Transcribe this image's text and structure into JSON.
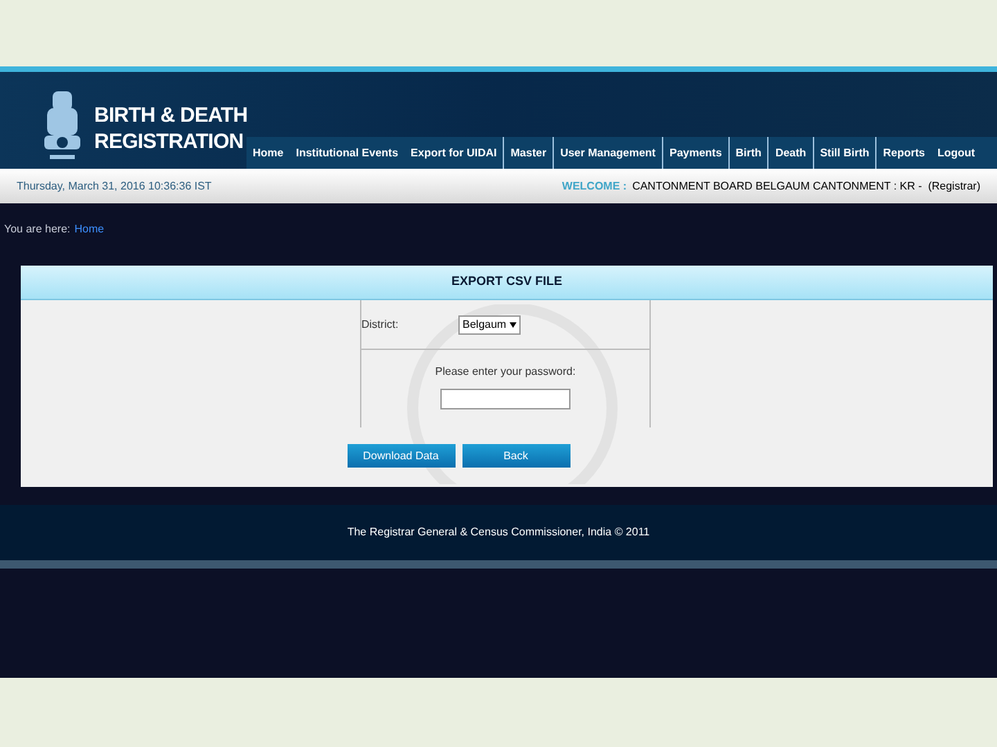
{
  "header": {
    "title_line_1": "BIRTH & DEATH",
    "title_line_2": "REGISTRATION"
  },
  "nav": [
    {
      "label": "Home"
    },
    {
      "label": "Institutional Events"
    },
    {
      "label": "Export for UIDAI"
    },
    {
      "label": "Master"
    },
    {
      "label": "User Management"
    },
    {
      "label": "Payments"
    },
    {
      "label": "Birth"
    },
    {
      "label": "Death"
    },
    {
      "label": "Still Birth"
    },
    {
      "label": "Reports"
    },
    {
      "label": "Logout"
    }
  ],
  "info_bar": {
    "datetime": "Thursday, March 31, 2016 10:36:36 IST",
    "welcome_label": "WELCOME :",
    "welcome_user": "CANTONMENT BOARD BELGAUM CANTONMENT : KR -  (Registrar)"
  },
  "breadcrumb": {
    "prefix": "You are here:",
    "link": "Home"
  },
  "panel": {
    "title": "EXPORT CSV FILE",
    "district_label": "District:",
    "district_value": "Belgaum",
    "password_label": "Please enter your password:",
    "buttons": [
      "Download Data",
      "Back"
    ]
  },
  "footer": "The Registrar General & Census Commissioner, India © 2011"
}
